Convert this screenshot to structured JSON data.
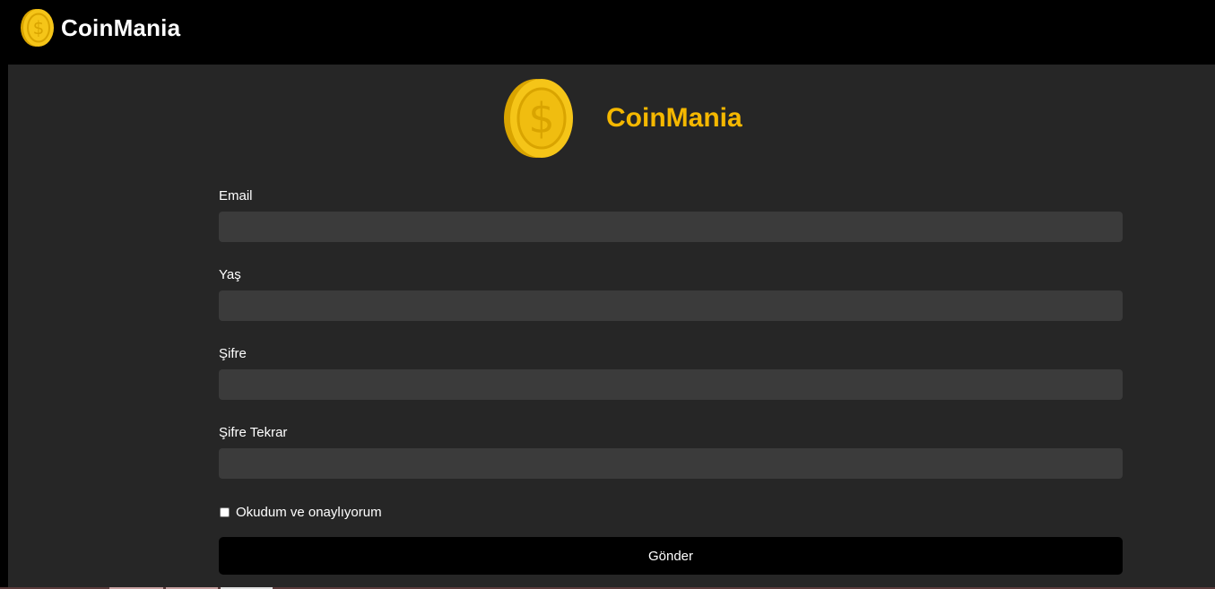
{
  "navbar": {
    "brand_name": "CoinMania",
    "logo_icon": "coin-dollar-icon"
  },
  "hero": {
    "title": "CoinMania",
    "logo_icon": "coin-dollar-icon",
    "accent_color": "#f5b800"
  },
  "form": {
    "fields": [
      {
        "label": "Email",
        "value": "",
        "placeholder": ""
      },
      {
        "label": "Yaş",
        "value": "",
        "placeholder": ""
      },
      {
        "label": "Şifre",
        "value": "",
        "placeholder": ""
      },
      {
        "label": "Şifre Tekrar",
        "value": "",
        "placeholder": ""
      }
    ],
    "consent_label": "Okudum ve onaylıyorum",
    "consent_checked": false,
    "submit_label": "Gönder"
  },
  "colors": {
    "navbar_bg": "#000000",
    "page_bg": "#262626",
    "input_bg": "#3b3b3b",
    "button_bg": "#000000",
    "coin_gold": "#f5c518"
  }
}
